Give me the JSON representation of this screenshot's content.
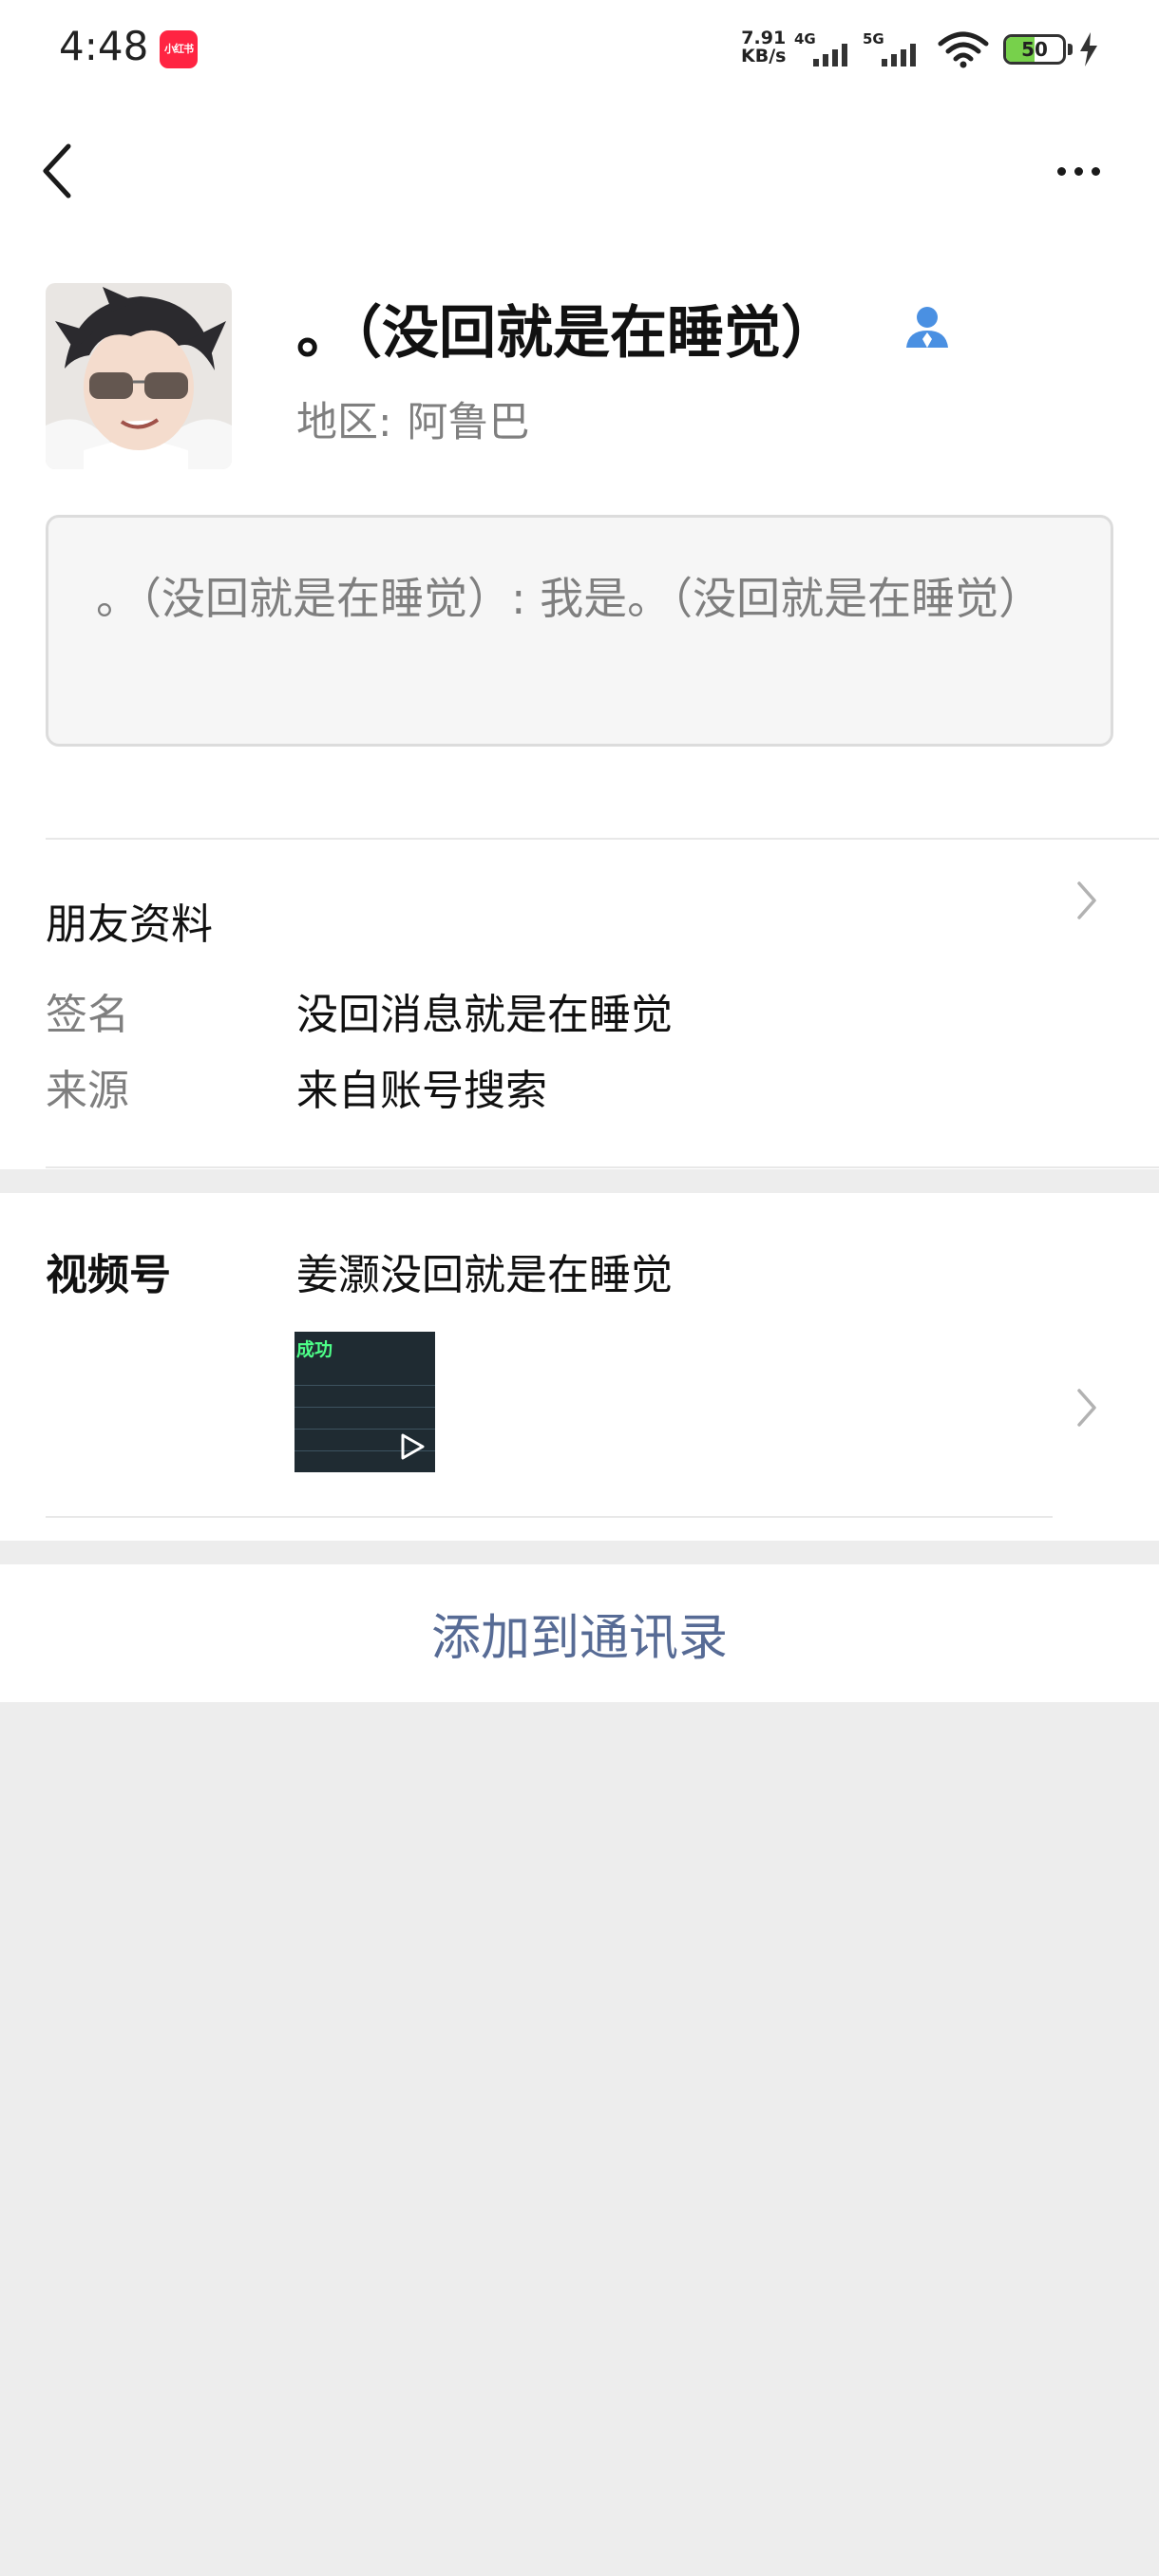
{
  "status_bar": {
    "time": "4:48",
    "app_badge": "小红书",
    "net_speed_value": "7.91",
    "net_speed_unit": "KB/s",
    "signal_1": "4G",
    "signal_2": "5G",
    "battery": "50",
    "battery_level_percent": 50
  },
  "nav": {
    "back_icon": "chevron-left-icon",
    "more_icon": "more-dots-icon"
  },
  "profile": {
    "nickname": "。（没回就是在睡觉）",
    "region_label": "地区:",
    "region_value": "阿鲁巴",
    "verified_icon": "person-badge-icon"
  },
  "greeting": {
    "text": "。（没回就是在睡觉）: 我是。（没回就是在睡觉）"
  },
  "friend_info": {
    "title": "朋友资料",
    "rows": [
      {
        "label": "签名",
        "value": "没回消息就是在睡觉"
      },
      {
        "label": "来源",
        "value": "来自账号搜索"
      }
    ]
  },
  "channels": {
    "label": "视频号",
    "name": "姜灏没回就是在睡觉",
    "thumb_title": "成功"
  },
  "actions": {
    "add_contact": "添加到通讯录"
  },
  "colors": {
    "link_blue": "#576b95",
    "background": "#ededed",
    "secondary_text": "#7f7f7f"
  }
}
